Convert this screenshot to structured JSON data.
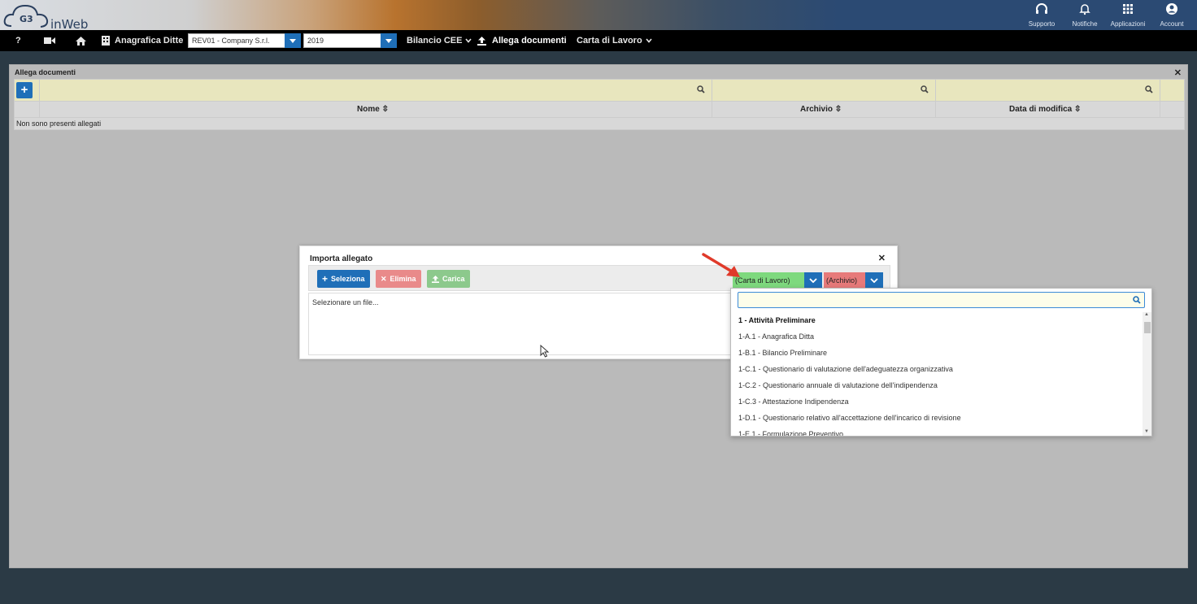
{
  "header": {
    "logo_text": "inWeb",
    "logo_badge": "G3",
    "icons": [
      {
        "name": "headset-icon",
        "label": "Supporto"
      },
      {
        "name": "bell-icon",
        "label": "Notifiche"
      },
      {
        "name": "apps-grid-icon",
        "label": "Applicazioni"
      },
      {
        "name": "user-circle-icon",
        "label": "Account"
      }
    ]
  },
  "navbar": {
    "help_label": "?",
    "anagrafica_label": "Anagrafica Ditte",
    "company_value": "REV01 - Company S.r.l.",
    "year_value": "2019",
    "bilancio_label": "Bilancio CEE",
    "allega_label": "Allega documenti",
    "carta_label": "Carta di Lavoro"
  },
  "panel": {
    "title": "Allega documenti",
    "add_label": "+",
    "columns": [
      "Nome",
      "Archivio",
      "Data di modifica"
    ],
    "empty_message": "Non sono presenti allegati"
  },
  "modal": {
    "title": "Importa allegato",
    "buttons": {
      "select": "Seleziona",
      "delete": "Elimina",
      "upload": "Carica"
    },
    "body_text": "Selezionare un file...",
    "combo_carta": "(Carta di Lavoro)",
    "combo_archivio": "(Archivio)"
  },
  "dropdown": {
    "search_value": "",
    "items": [
      {
        "label": "1 - Attività Preliminare",
        "bold": true
      },
      {
        "label": "1-A.1 - Anagrafica Ditta",
        "bold": false
      },
      {
        "label": "1-B.1 - Bilancio Preliminare",
        "bold": false
      },
      {
        "label": "1-C.1 - Questionario di valutazione dell'adeguatezza organizzativa",
        "bold": false
      },
      {
        "label": "1-C.2 - Questionario annuale di valutazione dell'indipendenza",
        "bold": false
      },
      {
        "label": "1-C.3 - Attestazione Indipendenza",
        "bold": false
      },
      {
        "label": "1-D.1 - Questionario relativo all'accettazione dell'incarico di revisione",
        "bold": false
      },
      {
        "label": "1-E.1 - Formulazione Preventivo",
        "bold": false
      }
    ]
  },
  "colors": {
    "accent_blue": "#1f6fb8",
    "delete_red": "#e98a8a",
    "upload_green": "#8cc98c",
    "combo_green": "#7ed97e",
    "combo_red": "#e77a7a",
    "arrow_red": "#e03a2a"
  }
}
